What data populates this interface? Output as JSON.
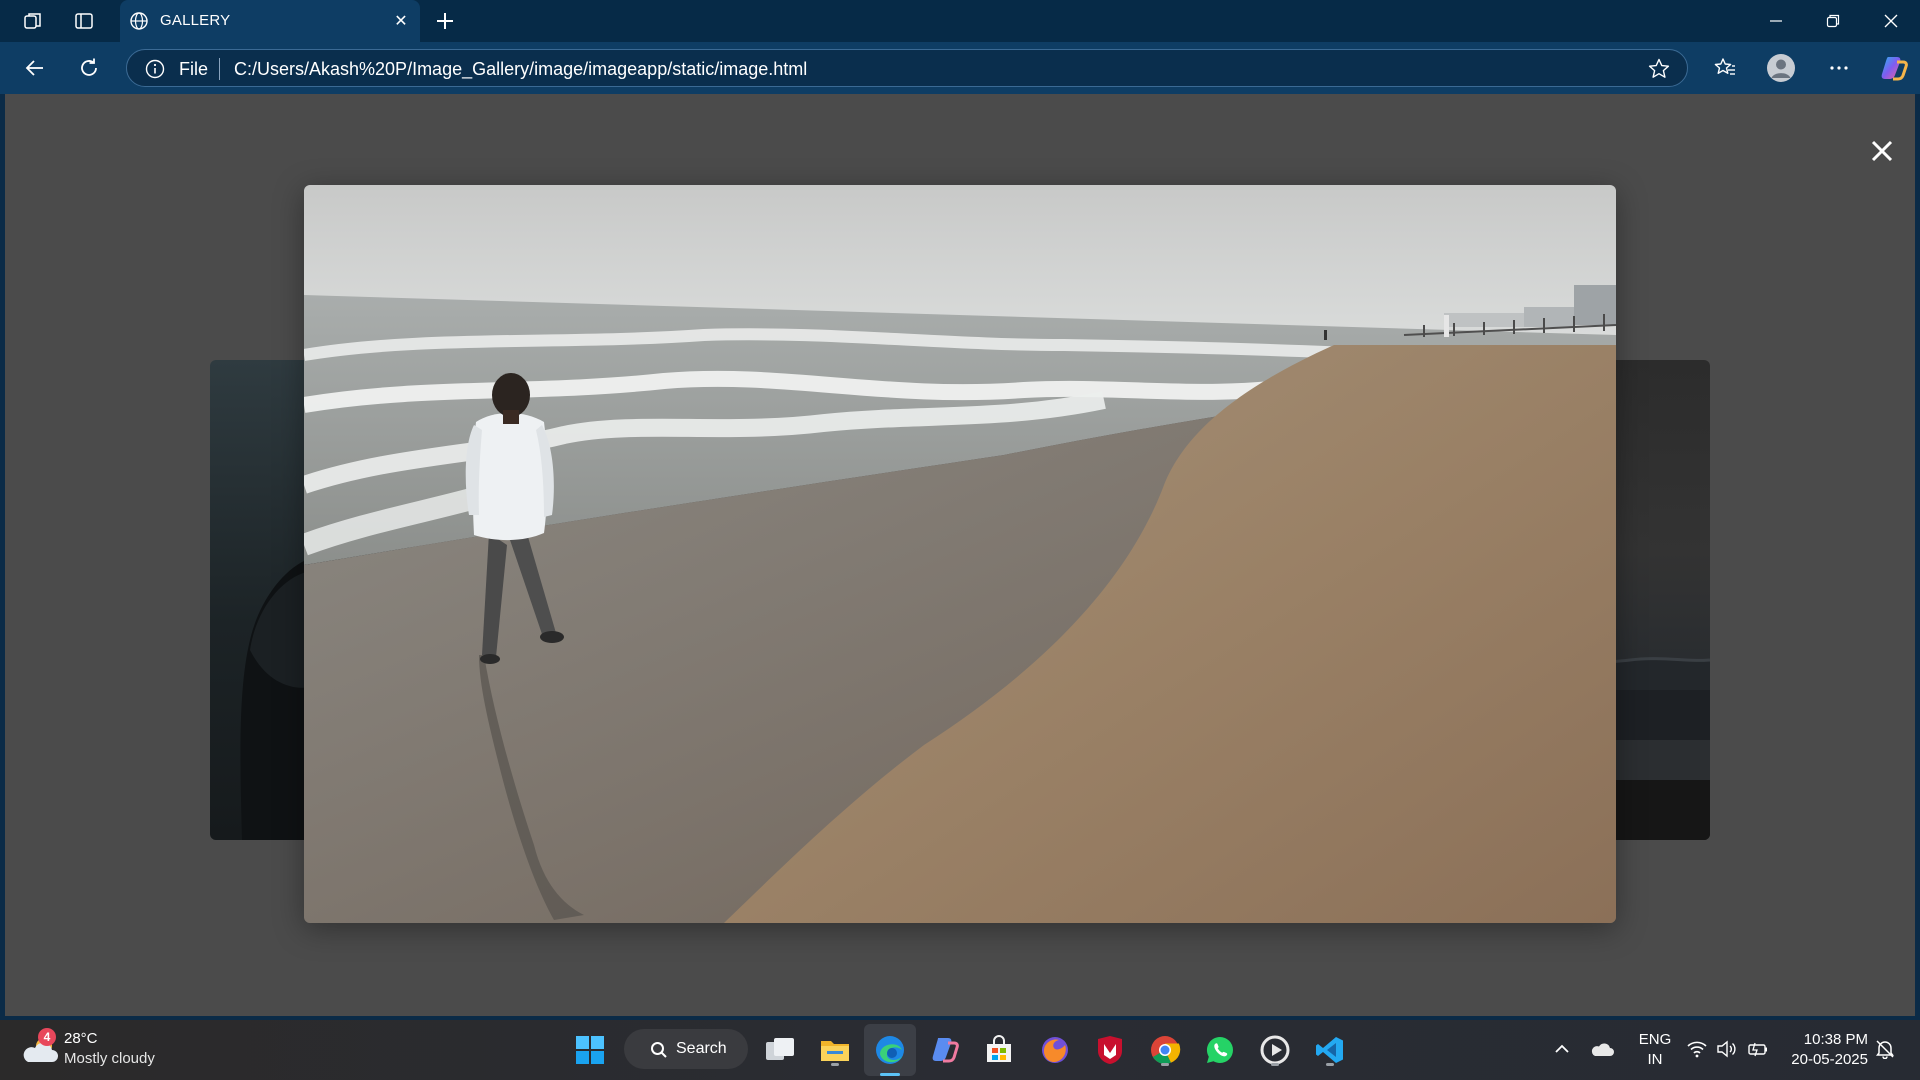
{
  "browser": {
    "tab_title": "GALLERY",
    "address_scheme": "File",
    "address_url": "C:/Users/Akash%20P/Image_Gallery/image/imageapp/static/image.html"
  },
  "lightbox": {
    "main_image": "beach-shoreline-man-walking",
    "prev_image": "person-in-hoodie-dark",
    "next_image": "dark-sea-horizon"
  },
  "taskbar": {
    "weather_badge": "4",
    "temperature": "28°C",
    "condition": "Mostly cloudy",
    "search_label": "Search",
    "lang_line1": "ENG",
    "lang_line2": "IN",
    "time": "10:38 PM",
    "date": "20-05-2025"
  },
  "colors": {
    "titlebar": "#062a47",
    "toolbar": "#0e3d64",
    "overlay": "#4b4b4b",
    "taskbar": "#2a2c33"
  }
}
